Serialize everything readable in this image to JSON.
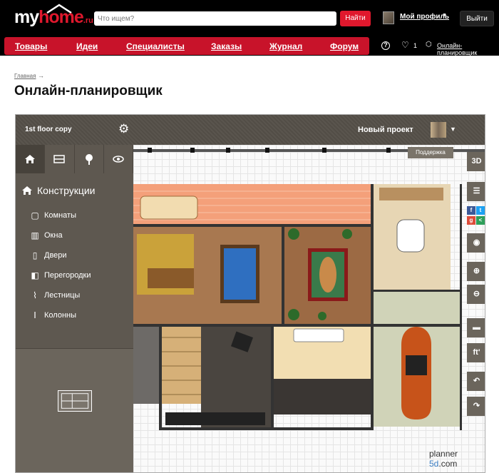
{
  "header": {
    "logo": {
      "my": "my",
      "home": "home",
      "ru": ".ru"
    },
    "search_placeholder": "Что ищем?",
    "search_button": "Найти",
    "profile_label": "Мой профиль",
    "logout_button": "Выйти"
  },
  "nav": {
    "items": [
      "Товары",
      "Идеи",
      "Специалисты",
      "Заказы",
      "Журнал",
      "Форум"
    ],
    "help": "?",
    "favorites_count": "1",
    "planner_link": "Онлайн-планировщик"
  },
  "breadcrumb": {
    "home": "Главная",
    "arrow": "→"
  },
  "page": {
    "title": "Онлайн-планировщик"
  },
  "planner": {
    "floor_name": "1st floor copy",
    "project_name": "Новый проект",
    "support_label": "Поддержка",
    "category_title": "Конструкции",
    "items": [
      "Комнаты",
      "Окна",
      "Двери",
      "Перегородки",
      "Лестницы",
      "Колонны"
    ],
    "right_buttons": [
      "3D",
      "ft'"
    ],
    "brand": {
      "a": "planner ",
      "b": "5d",
      "c": ".com"
    }
  },
  "colors": {
    "accent": "#e0182d",
    "nav": "#c8132a",
    "panel": "#5e5850"
  }
}
